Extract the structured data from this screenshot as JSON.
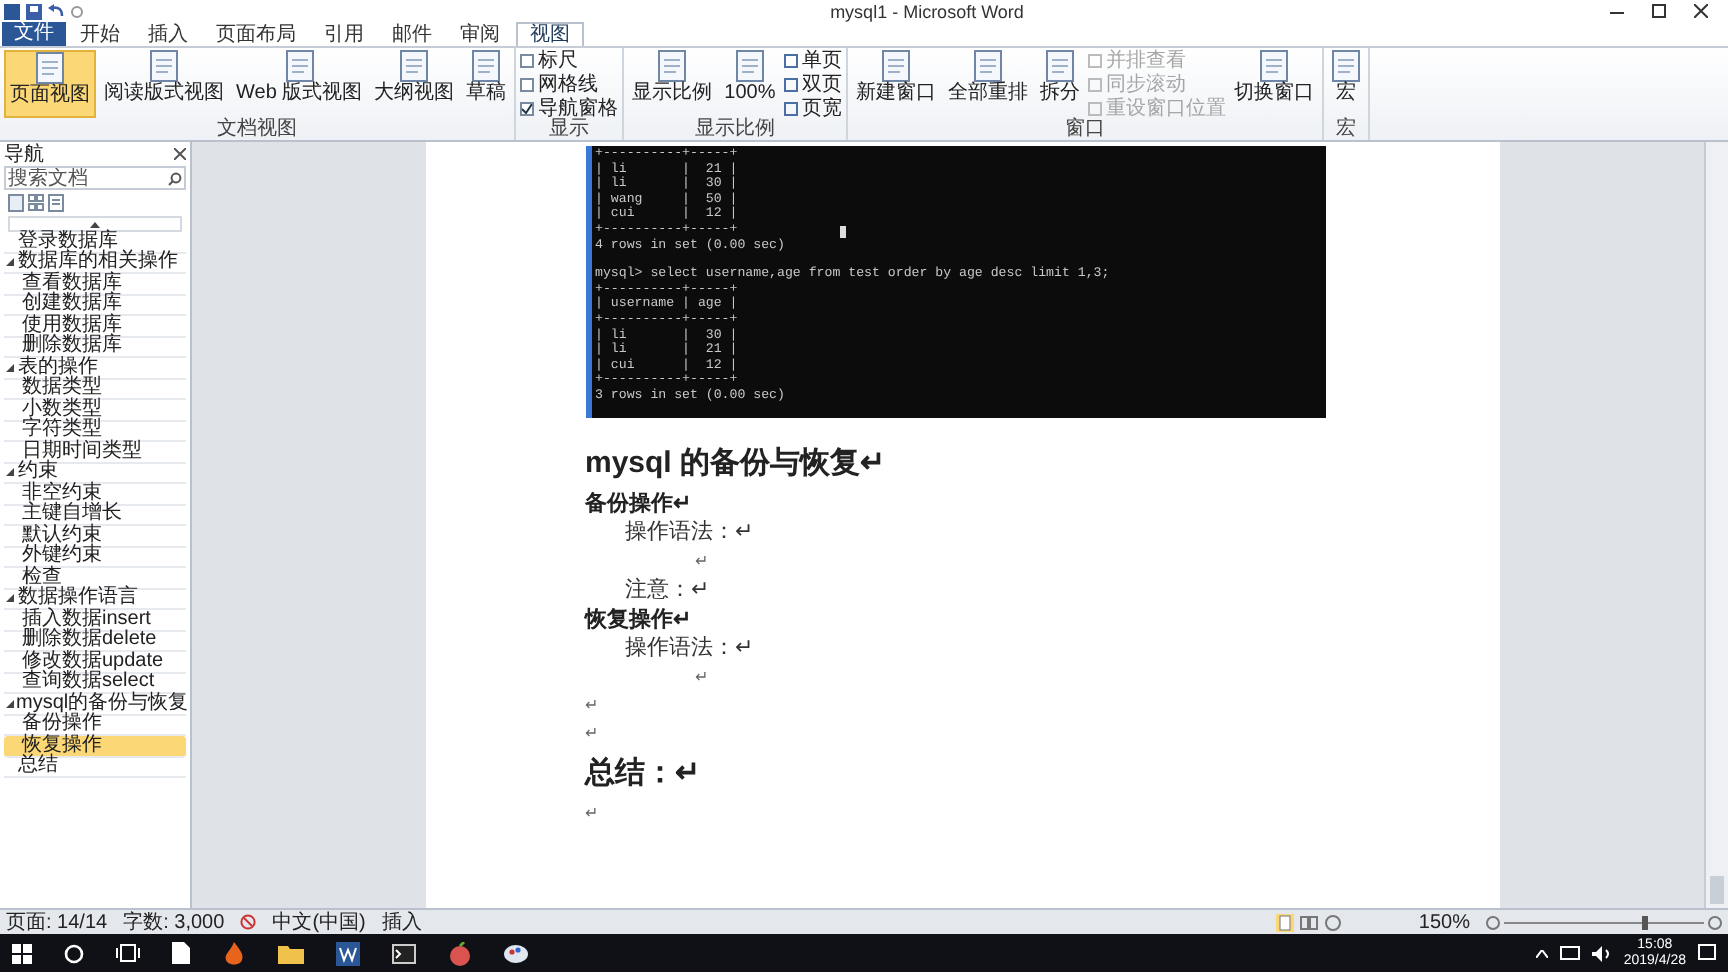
{
  "window": {
    "title": "mysql1 - Microsoft Word"
  },
  "ribbon": {
    "tabs": [
      {
        "label": "文件",
        "kind": "file"
      },
      {
        "label": "开始",
        "selected": false,
        "kind": "tab"
      },
      {
        "label": "插入",
        "selected": false,
        "kind": "tab"
      },
      {
        "label": "页面布局",
        "selected": false,
        "kind": "tab"
      },
      {
        "label": "引用",
        "selected": false,
        "kind": "tab"
      },
      {
        "label": "邮件",
        "selected": false,
        "kind": "tab"
      },
      {
        "label": "审阅",
        "selected": false,
        "kind": "tab"
      },
      {
        "label": "视图",
        "selected": true,
        "kind": "tab"
      }
    ],
    "groups": [
      {
        "label": "文档视图",
        "items": [
          {
            "kind": "large",
            "label": "页面视图",
            "selected": true
          },
          {
            "kind": "large",
            "label": "阅读版式视图",
            "selected": false
          },
          {
            "kind": "large",
            "label": "Web 版式视图",
            "selected": false
          },
          {
            "kind": "large",
            "label": "大纲视图",
            "selected": false
          },
          {
            "kind": "large",
            "label": "草稿",
            "selected": false
          }
        ]
      },
      {
        "label": "显示",
        "items": [
          {
            "kind": "check",
            "label": "标尺",
            "checked": false
          },
          {
            "kind": "check",
            "label": "网格线",
            "checked": false
          },
          {
            "kind": "check",
            "label": "导航窗格",
            "checked": true
          }
        ]
      },
      {
        "label": "显示比例",
        "items": [
          {
            "kind": "large",
            "label": "显示比例",
            "selected": false
          },
          {
            "kind": "large",
            "label": "100%",
            "selected": false
          },
          {
            "kind": "small",
            "label": "单页",
            "disabled": false
          },
          {
            "kind": "small",
            "label": "双页",
            "disabled": false
          },
          {
            "kind": "small",
            "label": "页宽",
            "disabled": false
          }
        ]
      },
      {
        "label": "窗口",
        "items": [
          {
            "kind": "large",
            "label": "新建窗口",
            "selected": false
          },
          {
            "kind": "large",
            "label": "全部重排",
            "selected": false
          },
          {
            "kind": "large",
            "label": "拆分",
            "selected": false
          },
          {
            "kind": "small",
            "label": "并排查看",
            "disabled": true
          },
          {
            "kind": "small",
            "label": "同步滚动",
            "disabled": true
          },
          {
            "kind": "small",
            "label": "重设窗口位置",
            "disabled": true
          },
          {
            "kind": "large",
            "label": "切换窗口",
            "selected": false
          }
        ]
      },
      {
        "label": "宏",
        "items": [
          {
            "kind": "large",
            "label": "宏",
            "selected": false
          }
        ]
      }
    ]
  },
  "navigation": {
    "title": "导航",
    "search": {
      "placeholder": "搜索文档"
    },
    "headings": [
      {
        "label": "登录数据库",
        "selected": false
      },
      {
        "label": "数据库的相关操作",
        "selected": false,
        "expanded": true,
        "children": [
          {
            "label": "查看数据库",
            "selected": false
          },
          {
            "label": "创建数据库",
            "selected": false
          },
          {
            "label": "使用数据库",
            "selected": false
          },
          {
            "label": "删除数据库",
            "selected": false
          }
        ]
      },
      {
        "label": "表的操作",
        "selected": false,
        "expanded": true,
        "children": [
          {
            "label": "数据类型",
            "selected": false
          },
          {
            "label": "小数类型",
            "selected": false
          },
          {
            "label": "字符类型",
            "selected": false
          },
          {
            "label": "日期时间类型",
            "selected": false
          }
        ]
      },
      {
        "label": "约束",
        "selected": false,
        "expanded": true,
        "children": [
          {
            "label": "非空约束",
            "selected": false
          },
          {
            "label": "主键自增长",
            "selected": false
          },
          {
            "label": "默认约束",
            "selected": false
          },
          {
            "label": "外键约束",
            "selected": false
          },
          {
            "label": "检查",
            "selected": false
          }
        ]
      },
      {
        "label": "数据操作语言",
        "selected": false,
        "expanded": true,
        "children": [
          {
            "label": "插入数据insert",
            "selected": false
          },
          {
            "label": "删除数据delete",
            "selected": false
          },
          {
            "label": "修改数据update",
            "selected": false
          },
          {
            "label": "查询数据select",
            "selected": false
          }
        ]
      },
      {
        "label": "mysql的备份与恢复",
        "selected": false,
        "expanded": true,
        "children": [
          {
            "label": "备份操作",
            "selected": false
          },
          {
            "label": "恢复操作",
            "selected": true
          }
        ]
      },
      {
        "label": "总结",
        "selected": false
      }
    ]
  },
  "document": {
    "terminal_blocks": [
      [
        "+----------+-----+",
        "| li       |  21 |",
        "| li       |  30 |",
        "| wang     |  50 |",
        "| cui      |  12 |",
        "+----------+-----+",
        "4 rows in set (0.00 sec)"
      ],
      [
        "mysql> select username,age from test order by age desc limit 1,3;",
        "+----------+-----+",
        "| username | age |",
        "+----------+-----+",
        "| li       |  30 |",
        "| li       |  21 |",
        "| cui      |  12 |",
        "+----------+-----+",
        "3 rows in set (0.00 sec)"
      ]
    ],
    "blocks": [
      {
        "kind": "heading1",
        "text": "mysql 的备份与恢复↵"
      },
      {
        "kind": "heading2",
        "text": "备份操作↵"
      },
      {
        "kind": "indent",
        "text": "操作语法：↵"
      },
      {
        "kind": "center",
        "text": "↵"
      },
      {
        "kind": "indent",
        "text": "注意：↵"
      },
      {
        "kind": "heading2",
        "text": "恢复操作↵"
      },
      {
        "kind": "indent",
        "text": "操作语法：↵"
      },
      {
        "kind": "center",
        "text": "↵"
      },
      {
        "kind": "body",
        "text": "↵"
      },
      {
        "kind": "body",
        "text": "↵"
      },
      {
        "kind": "heading1",
        "text": "总结：↵"
      },
      {
        "kind": "body",
        "text": "↵"
      }
    ]
  },
  "status_bar": {
    "page": "页面: 14/14",
    "words": "字数: 3,000",
    "language": "中文(中国)",
    "mode": "插入",
    "zoom": "150%",
    "zoom_slider": {
      "level": 0.7
    }
  },
  "taskbar": {
    "time": "15:08",
    "date": "2019/4/28"
  }
}
